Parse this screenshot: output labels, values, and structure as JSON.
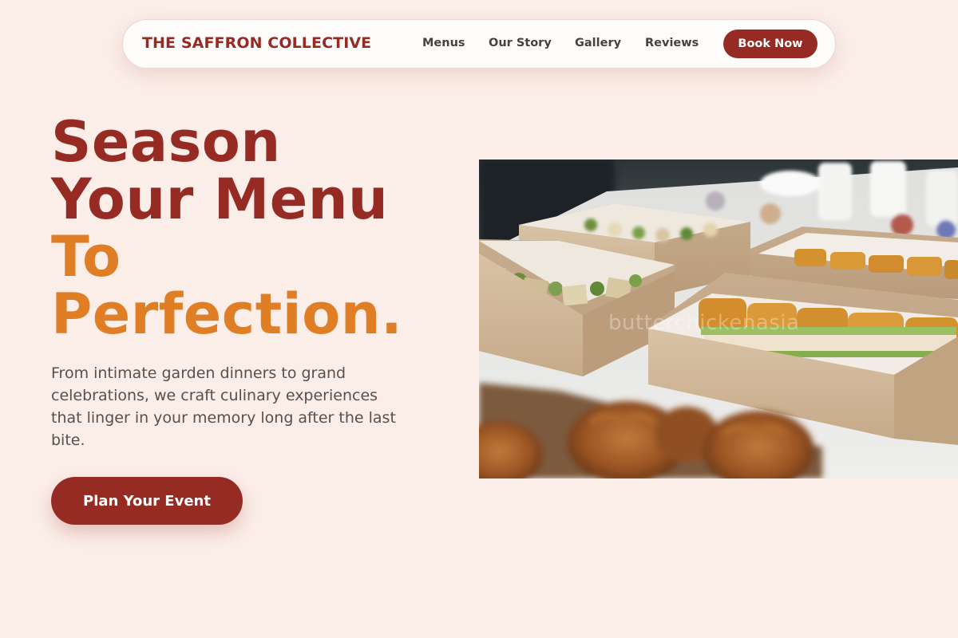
{
  "header": {
    "brand": "THE SAFFRON COLLECTIVE",
    "nav_items": [
      {
        "label": "Menus"
      },
      {
        "label": "Our Story"
      },
      {
        "label": "Gallery"
      },
      {
        "label": "Reviews"
      }
    ],
    "cta_label": "Book Now"
  },
  "hero": {
    "headline_line1": "Season",
    "headline_line2": "Your Menu",
    "headline_line3": "To",
    "headline_line4": "Perfection.",
    "description": "From intimate garden dinners to grand celebrations, we craft culinary experiences that linger in your memory long after the last bite.",
    "cta_label": "Plan Your Event",
    "image_watermark": "butterchickenasia"
  },
  "colors": {
    "background": "#fbede7",
    "brand_red": "#962b24",
    "accent_orange": "#e07e26",
    "body_text": "#58504c"
  }
}
